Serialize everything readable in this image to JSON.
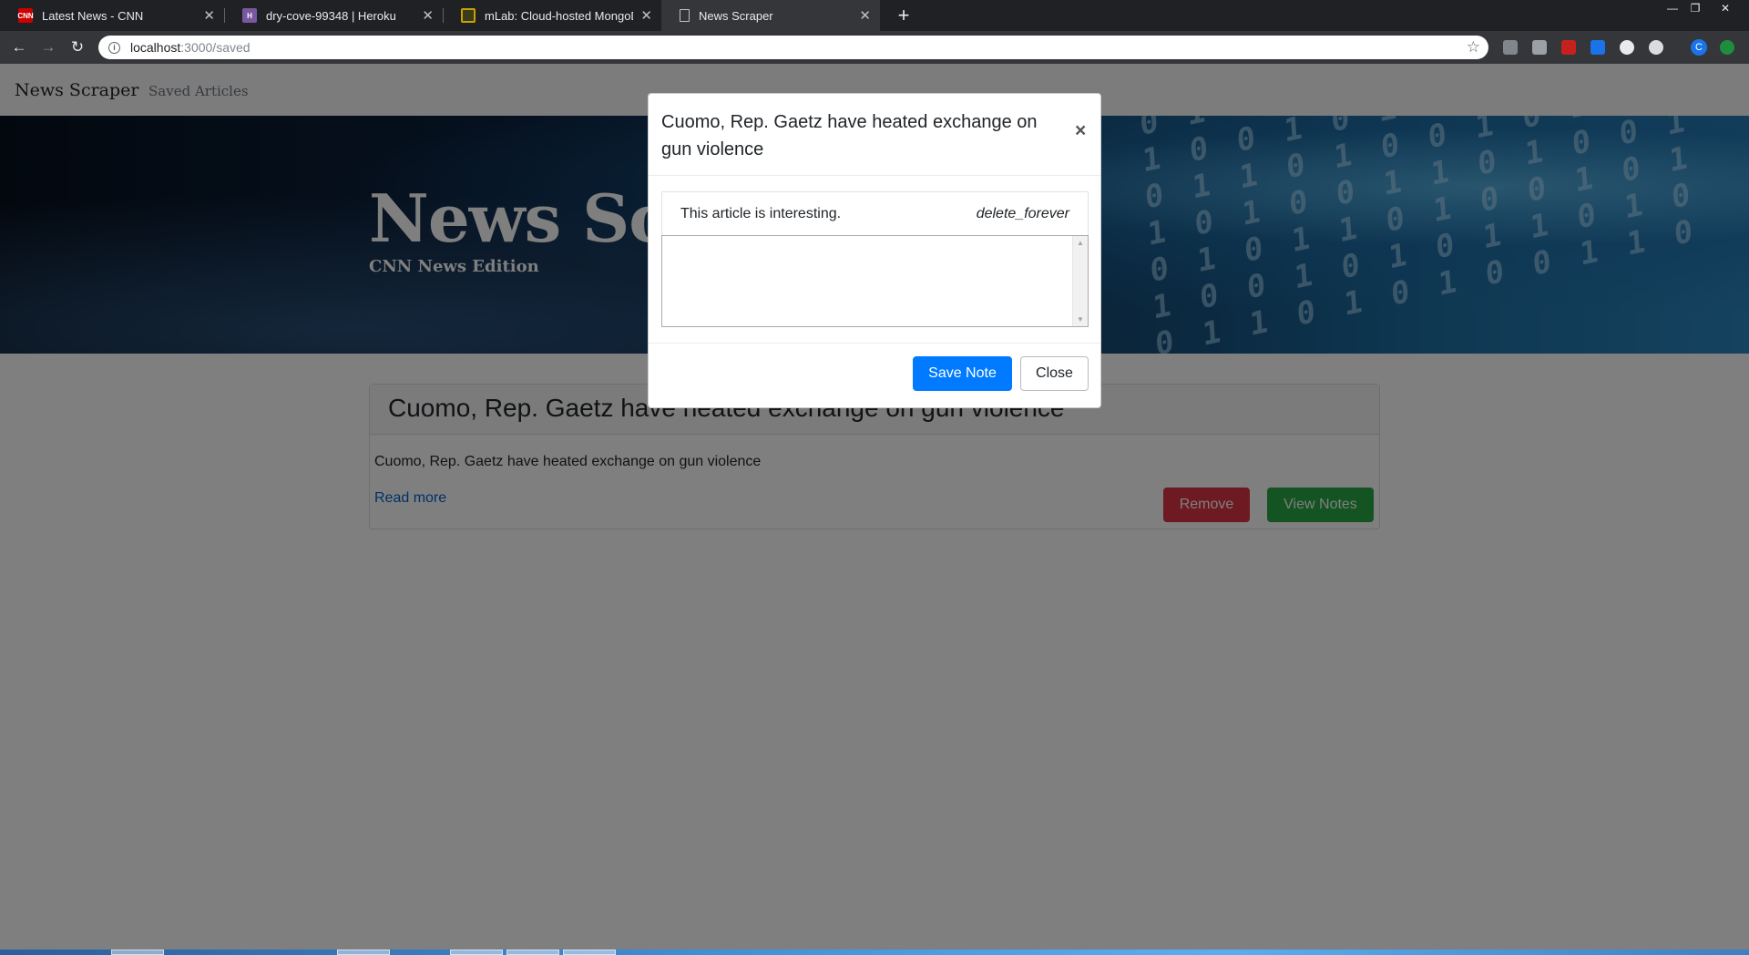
{
  "browser": {
    "tabs": [
      {
        "title": "Latest News - CNN",
        "favicon_color": "#cc0000",
        "favicon_text": "CNN",
        "active": false
      },
      {
        "title": "dry-cove-99348 | Heroku",
        "favicon_color": "#79589f",
        "favicon_text": "H",
        "active": false
      },
      {
        "title": "mLab: Cloud-hosted MongoDB",
        "favicon_color": "#c8a200",
        "favicon_text": "",
        "active": false
      },
      {
        "title": "News Scraper",
        "favicon_color": "#35363a",
        "favicon_text": "",
        "active": true
      }
    ],
    "url_host": "localhost",
    "url_path": ":3000/saved",
    "profile_initial": "C"
  },
  "site": {
    "brand": "News Scraper",
    "nav_link": "Saved Articles",
    "hero_title": "News Scraper",
    "hero_subtitle": "CNN News Edition"
  },
  "article": {
    "title": "Cuomo, Rep. Gaetz have heated exchange on gun violence",
    "summary": "Cuomo, Rep. Gaetz have heated exchange on gun violence",
    "read_more": "Read more",
    "remove_label": "Remove",
    "view_notes_label": "View Notes"
  },
  "modal": {
    "title": "Cuomo, Rep. Gaetz have heated exchange on gun violence",
    "close_x": "×",
    "notes": [
      {
        "text": "This article is interesting.",
        "delete_label": "delete_forever"
      }
    ],
    "new_note_value": "",
    "save_label": "Save Note",
    "close_label": "Close"
  }
}
